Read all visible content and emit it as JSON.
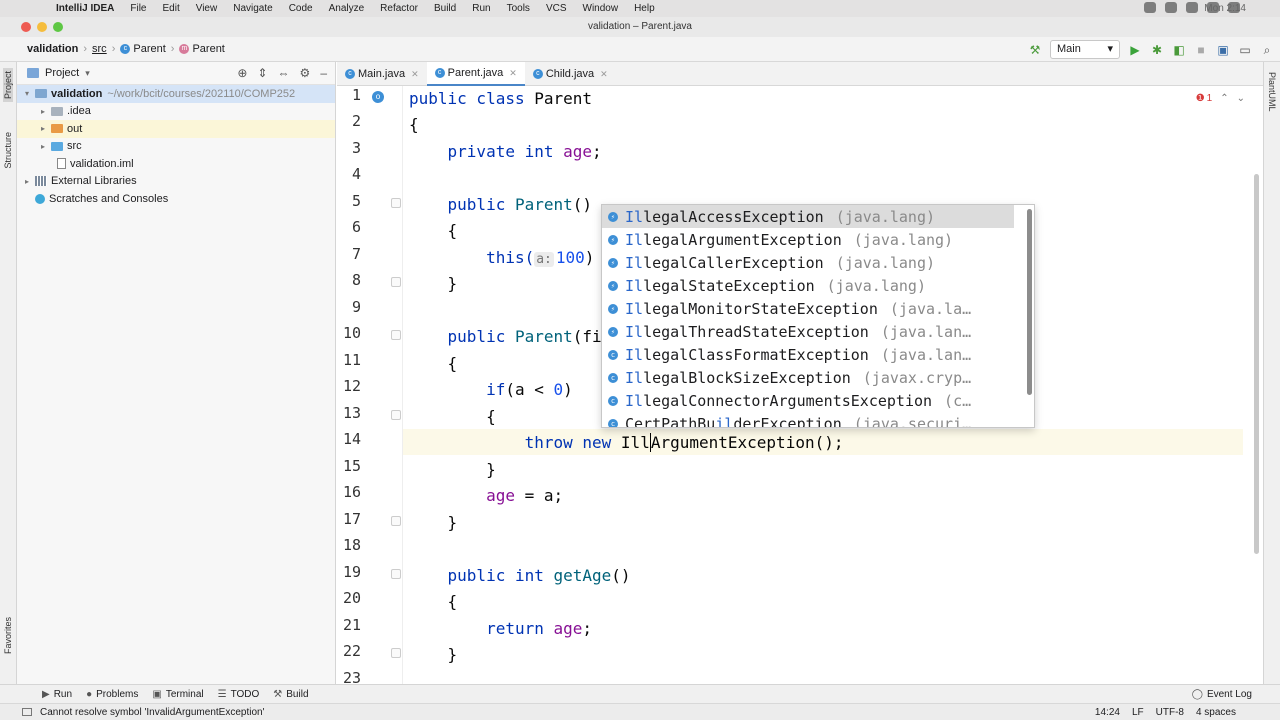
{
  "menubar": {
    "items": [
      "IntelliJ IDEA",
      "File",
      "Edit",
      "View",
      "Navigate",
      "Code",
      "Analyze",
      "Refactor",
      "Build",
      "Run",
      "Tools",
      "VCS",
      "Window",
      "Help"
    ],
    "clock": "Mon 2:14"
  },
  "window": {
    "title": "validation – Parent.java"
  },
  "breadcrumb": {
    "project": "validation",
    "dir": "src",
    "class": "Parent",
    "member": "Parent"
  },
  "run_config": {
    "label": "Main"
  },
  "project_panel": {
    "title": "Project",
    "tree": [
      {
        "label": "validation",
        "extra": "~/work/bcit/courses/202110/COMP252",
        "kind": "root"
      },
      {
        "label": ".idea",
        "kind": "folder"
      },
      {
        "label": "out",
        "kind": "folder-out"
      },
      {
        "label": "src",
        "kind": "folder-src"
      },
      {
        "label": "validation.iml",
        "kind": "file"
      },
      {
        "label": "External Libraries",
        "kind": "lib"
      },
      {
        "label": "Scratches and Consoles",
        "kind": "scratch"
      }
    ]
  },
  "left_strip": {
    "project": "Project",
    "structure": "Structure",
    "favorites": "Favorites"
  },
  "right_strip": {
    "plantuml": "PlantUML"
  },
  "tabs": [
    {
      "label": "Main.java",
      "active": false
    },
    {
      "label": "Parent.java",
      "active": true
    },
    {
      "label": "Child.java",
      "active": false
    }
  ],
  "error_count": "1",
  "code": {
    "line_numbers": [
      "1",
      "2",
      "3",
      "4",
      "5",
      "6",
      "7",
      "8",
      "9",
      "10",
      "11",
      "12",
      "13",
      "14",
      "15",
      "16",
      "17",
      "18",
      "19",
      "20",
      "21",
      "22",
      "23"
    ],
    "l1": {
      "kw1": "public class ",
      "name": "Parent"
    },
    "l2": "{",
    "l3": {
      "kw": "private int ",
      "fld": "age",
      "end": ";"
    },
    "l5": {
      "kw": "public ",
      "fn": "Parent",
      "end": "()"
    },
    "l6": "{",
    "l7": {
      "call": "this(",
      "hint": "a:",
      "num": "100",
      "end": ")"
    },
    "l8": "}",
    "l10": {
      "kw": "public ",
      "fn": "Parent",
      "end": "(fi"
    },
    "l11": "{",
    "l12": {
      "kw": "if",
      "mid": "(a < ",
      "num": "0",
      "end": ")"
    },
    "l13": "{",
    "l14": {
      "kw": "throw new ",
      "typed": "Ill",
      "rest": "ArgumentException();"
    },
    "l15": "}",
    "l16": {
      "fld": "age",
      "end": " = a;"
    },
    "l17": "}",
    "l19": {
      "kw": "public int ",
      "fn": "getAge",
      "end": "()"
    },
    "l20": "{",
    "l21": {
      "kw": "return ",
      "fld": "age",
      "end": ";"
    },
    "l22": "}"
  },
  "completion": {
    "prefix": "Il",
    "items": [
      {
        "name": "legalAccessException",
        "pkg": "(java.lang)",
        "icon": "exception-icon"
      },
      {
        "name": "legalArgumentException",
        "pkg": "(java.lang)",
        "icon": "exception-icon"
      },
      {
        "name": "legalCallerException",
        "pkg": "(java.lang)",
        "icon": "exception-icon"
      },
      {
        "name": "legalStateException",
        "pkg": "(java.lang)",
        "icon": "exception-icon"
      },
      {
        "name": "legalMonitorStateException",
        "pkg": "(java.la…",
        "icon": "exception-icon"
      },
      {
        "name": "legalThreadStateException",
        "pkg": "(java.lan…",
        "icon": "exception-icon"
      },
      {
        "name": "legalClassFormatException",
        "pkg": "(java.lan…",
        "icon": "class-icon"
      },
      {
        "name": "legalBlockSizeException",
        "pkg": "(javax.cryp…",
        "icon": "class-icon"
      },
      {
        "name": "legalConnectorArgumentsException",
        "pkg": "(c…",
        "icon": "class-icon"
      }
    ],
    "last": {
      "a": "CertPathBu",
      "b": "il",
      "c": "derException",
      "pkg": "(java.securi…"
    }
  },
  "bottom_tools": [
    "Run",
    "Problems",
    "Terminal",
    "TODO",
    "Build"
  ],
  "event_log": "Event Log",
  "status": {
    "message": "Cannot resolve symbol 'InvalidArgumentException'",
    "position": "14:24",
    "line_sep": "LF",
    "encoding": "UTF-8",
    "indent": "4 spaces"
  }
}
